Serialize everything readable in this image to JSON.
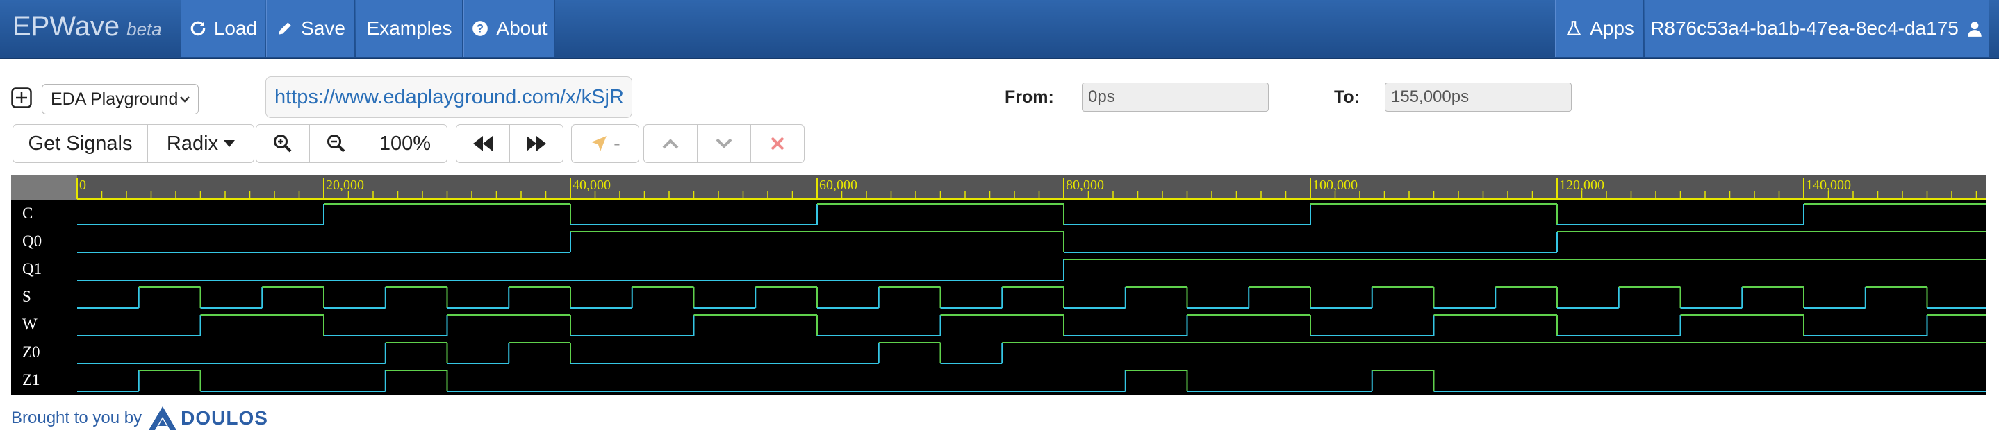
{
  "app": {
    "brand": "EPWave",
    "brand_suffix": "beta"
  },
  "nav": {
    "load": "Load",
    "save": "Save",
    "examples": "Examples",
    "about": "About",
    "apps": "Apps",
    "user": "R876c53a4-ba1b-47ea-8ec4-da175"
  },
  "toolbar": {
    "playground_select": "EDA Playground",
    "url": "https://www.edaplayground.com/x/kSjR",
    "from_label": "From:",
    "from_value": "0ps",
    "to_label": "To:",
    "to_value": "155,000ps",
    "get_signals": "Get Signals",
    "radix": "Radix",
    "zoom_level": "100%",
    "marker_label": "-"
  },
  "timeline": {
    "ticks": [
      "0",
      "20,000",
      "40,000",
      "60,000",
      "80,000",
      "100,000",
      "120,000",
      "140,000"
    ],
    "range_ps": [
      0,
      155000
    ]
  },
  "signals": [
    {
      "name": "C",
      "edges": [
        0,
        20000,
        40000,
        60000,
        80000,
        100000,
        120000,
        140000
      ],
      "initial": 0
    },
    {
      "name": "Q0",
      "edges": [
        0,
        40000,
        80000,
        120000
      ],
      "initial": 0
    },
    {
      "name": "Q1",
      "edges": [
        0,
        80000
      ],
      "initial": 0
    },
    {
      "name": "S",
      "edges": [
        0,
        5000,
        10000,
        15000,
        20000,
        25000,
        30000,
        35000,
        40000,
        45000,
        50000,
        55000,
        60000,
        65000,
        70000,
        75000,
        80000,
        85000,
        90000,
        95000,
        100000,
        105000,
        110000,
        115000,
        120000,
        125000,
        130000,
        135000,
        140000,
        145000,
        150000
      ],
      "initial": 0
    },
    {
      "name": "W",
      "edges": [
        0,
        10000,
        20000,
        30000,
        40000,
        50000,
        60000,
        70000,
        80000,
        90000,
        100000,
        110000,
        120000,
        130000,
        140000,
        150000
      ],
      "initial": 0
    },
    {
      "name": "Z0",
      "edges": [
        0,
        25000,
        30000,
        35000,
        40000,
        65000,
        70000,
        75000
      ],
      "initial": 0
    },
    {
      "name": "Z1",
      "edges": [
        0,
        5000,
        10000,
        25000,
        30000,
        85000,
        90000,
        105000,
        110000
      ],
      "initial": 0
    }
  ],
  "colors": {
    "wave_low": "#35c6e4",
    "wave_high": "#5fd14c",
    "timeline": "#e6e600",
    "ruler_bg": "#555555"
  },
  "footer": {
    "brought": "Brought to you by",
    "company": "DOULOS"
  }
}
